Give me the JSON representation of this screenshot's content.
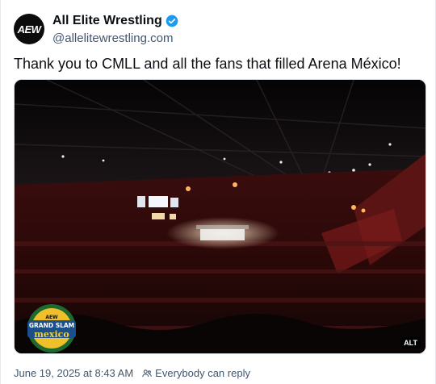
{
  "author": {
    "display_name": "All Elite Wrestling",
    "handle": "@allelitewrestling.com",
    "avatar_text": "AEW",
    "verified_color": "#1d9bf0"
  },
  "post": {
    "text": "Thank you to CMLL and all the fans that filled Arena México!",
    "image_logo": {
      "line1": "AEW",
      "line2": "GRAND SLAM",
      "line3": "mexico"
    },
    "alt_label": "ALT"
  },
  "meta": {
    "timestamp": "June 19, 2025 at 8:43 AM",
    "reply_setting": "Everybody can reply"
  },
  "icons": [
    "verified-badge-icon",
    "people-icon"
  ]
}
